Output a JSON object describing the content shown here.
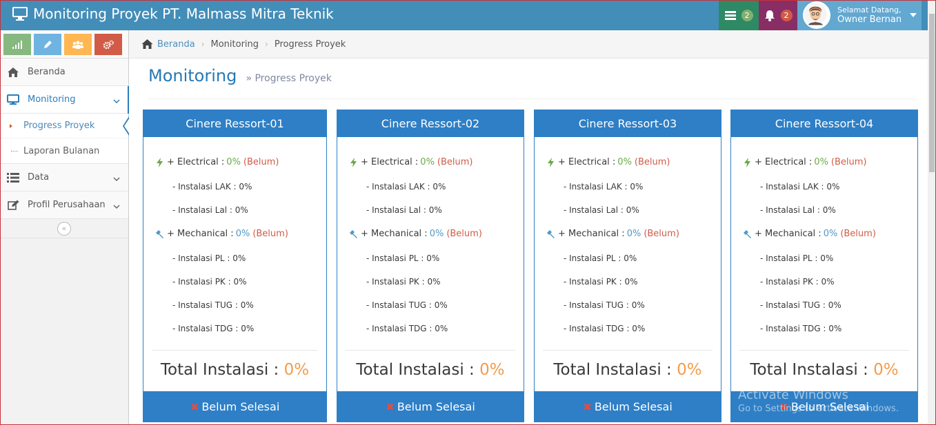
{
  "app": {
    "title": "Monitoring Proyek PT. Malmass Mitra Teknik"
  },
  "navbar": {
    "tasks_count": "2",
    "notifications_count": "2",
    "user": {
      "greeting": "Selamat Datang,",
      "name": "Owner Bernan"
    }
  },
  "sidebar": {
    "items": [
      {
        "label": "Beranda"
      },
      {
        "label": "Monitoring"
      },
      {
        "label": "Data"
      },
      {
        "label": "Profil Perusahaan"
      }
    ],
    "submenu": [
      {
        "label": "Progress Proyek"
      },
      {
        "label": "Laporan Bulanan"
      }
    ]
  },
  "breadcrumb": {
    "home": "Beranda",
    "section": "Monitoring",
    "current": "Progress Proyek"
  },
  "page": {
    "title": "Monitoring",
    "subtitle": "» Progress Proyek"
  },
  "cards": [
    {
      "title": "Cinere Ressort-01",
      "electrical": {
        "label": "+ Electrical :",
        "value": "0%",
        "status": "(Belum)"
      },
      "electrical_items": [
        "- Instalasi LAK : 0%",
        "- Instalasi Lal : 0%"
      ],
      "mechanical": {
        "label": "+ Mechanical :",
        "value": "0%",
        "status": "(Belum)"
      },
      "mechanical_items": [
        "- Instalasi PL : 0%",
        "- Instalasi PK : 0%",
        "- Instalasi TUG : 0%",
        "- Instalasi TDG : 0%"
      ],
      "total_label": "Total Instalasi :",
      "total_value": "0%",
      "footer": "Belum Selesai"
    },
    {
      "title": "Cinere Ressort-02",
      "electrical": {
        "label": "+ Electrical :",
        "value": "0%",
        "status": "(Belum)"
      },
      "electrical_items": [
        "- Instalasi LAK : 0%",
        "- Instalasi Lal : 0%"
      ],
      "mechanical": {
        "label": "+ Mechanical :",
        "value": "0%",
        "status": "(Belum)"
      },
      "mechanical_items": [
        "- Instalasi PL : 0%",
        "- Instalasi PK : 0%",
        "- Instalasi TUG : 0%",
        "- Instalasi TDG : 0%"
      ],
      "total_label": "Total Instalasi :",
      "total_value": "0%",
      "footer": "Belum Selesai"
    },
    {
      "title": "Cinere Ressort-03",
      "electrical": {
        "label": "+ Electrical :",
        "value": "0%",
        "status": "(Belum)"
      },
      "electrical_items": [
        "- Instalasi LAK : 0%",
        "- Instalasi Lal : 0%"
      ],
      "mechanical": {
        "label": "+ Mechanical :",
        "value": "0%",
        "status": "(Belum)"
      },
      "mechanical_items": [
        "- Instalasi PL : 0%",
        "- Instalasi PK : 0%",
        "- Instalasi TUG : 0%",
        "- Instalasi TDG : 0%"
      ],
      "total_label": "Total Instalasi :",
      "total_value": "0%",
      "footer": "Belum Selesai"
    },
    {
      "title": "Cinere Ressort-04",
      "electrical": {
        "label": "+ Electrical :",
        "value": "0%",
        "status": "(Belum)"
      },
      "electrical_items": [
        "- Instalasi LAK : 0%",
        "- Instalasi Lal : 0%"
      ],
      "mechanical": {
        "label": "+ Mechanical :",
        "value": "0%",
        "status": "(Belum)"
      },
      "mechanical_items": [
        "- Instalasi PL : 0%",
        "- Instalasi PK : 0%",
        "- Instalasi TUG : 0%",
        "- Instalasi TDG : 0%"
      ],
      "total_label": "Total Instalasi :",
      "total_value": "0%",
      "footer": "Belum Selesai"
    }
  ],
  "watermark": {
    "line1": "Activate Windows",
    "line2": "Go to Settings to activate Windows."
  },
  "colors": {
    "navbar": "#438eb9",
    "card_accent": "#2e7fc6",
    "percent_orange": "#f39c4c",
    "status_red": "#d15b47"
  }
}
